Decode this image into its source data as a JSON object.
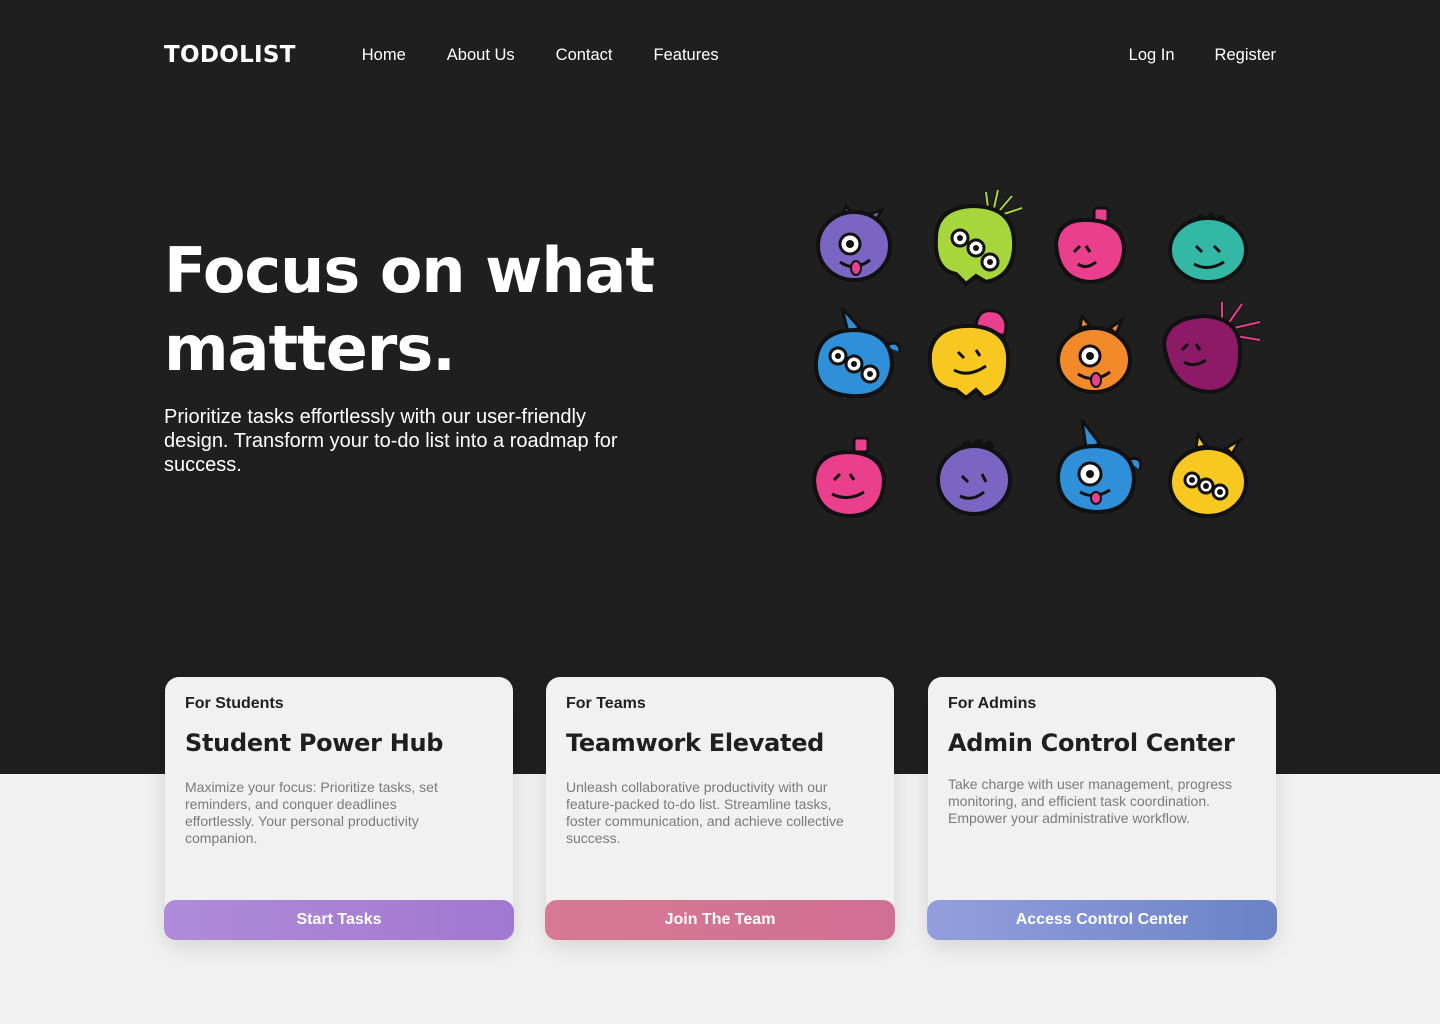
{
  "nav": {
    "logo": "TODOLIST",
    "links": [
      "Home",
      "About Us",
      "Contact",
      "Features"
    ],
    "login": "Log In",
    "register": "Register"
  },
  "hero": {
    "headline_line1": "Focus on what",
    "headline_line2": "matters.",
    "subtext": "Prioritize tasks effortlessly with our user-friendly design. Transform your to-do list into a roadmap for success."
  },
  "monsters": {
    "icon": "monster-illustration",
    "colors": [
      "#7a66c2",
      "#a6d63c",
      "#ea3f8c",
      "#34b8a6",
      "#2f8fd8",
      "#f7c820",
      "#f28a2c",
      "#8c1a66",
      "#ea3f8c",
      "#7a66c2",
      "#2f8fd8",
      "#f7c820"
    ]
  },
  "cards": [
    {
      "kicker": "For Students",
      "title": "Student Power Hub",
      "description": "Maximize your focus: Prioritize tasks, set reminders, and conquer deadlines effortlessly. Your personal productivity companion.",
      "button": "Start Tasks",
      "accent": "#a67cd2"
    },
    {
      "kicker": "For Teams",
      "title": "Teamwork Elevated",
      "description": "Unleash collaborative productivity with our feature-packed to-do list. Streamline tasks, foster communication, and achieve collective success.",
      "button": "Join The Team",
      "accent": "#d37292"
    },
    {
      "kicker": "For Admins",
      "title": "Admin Control Center",
      "description": "Take charge with user management, progress monitoring, and efficient task coordination. Empower your administrative workflow.",
      "button": "Access Control Center",
      "accent": "#7f90d1"
    }
  ]
}
